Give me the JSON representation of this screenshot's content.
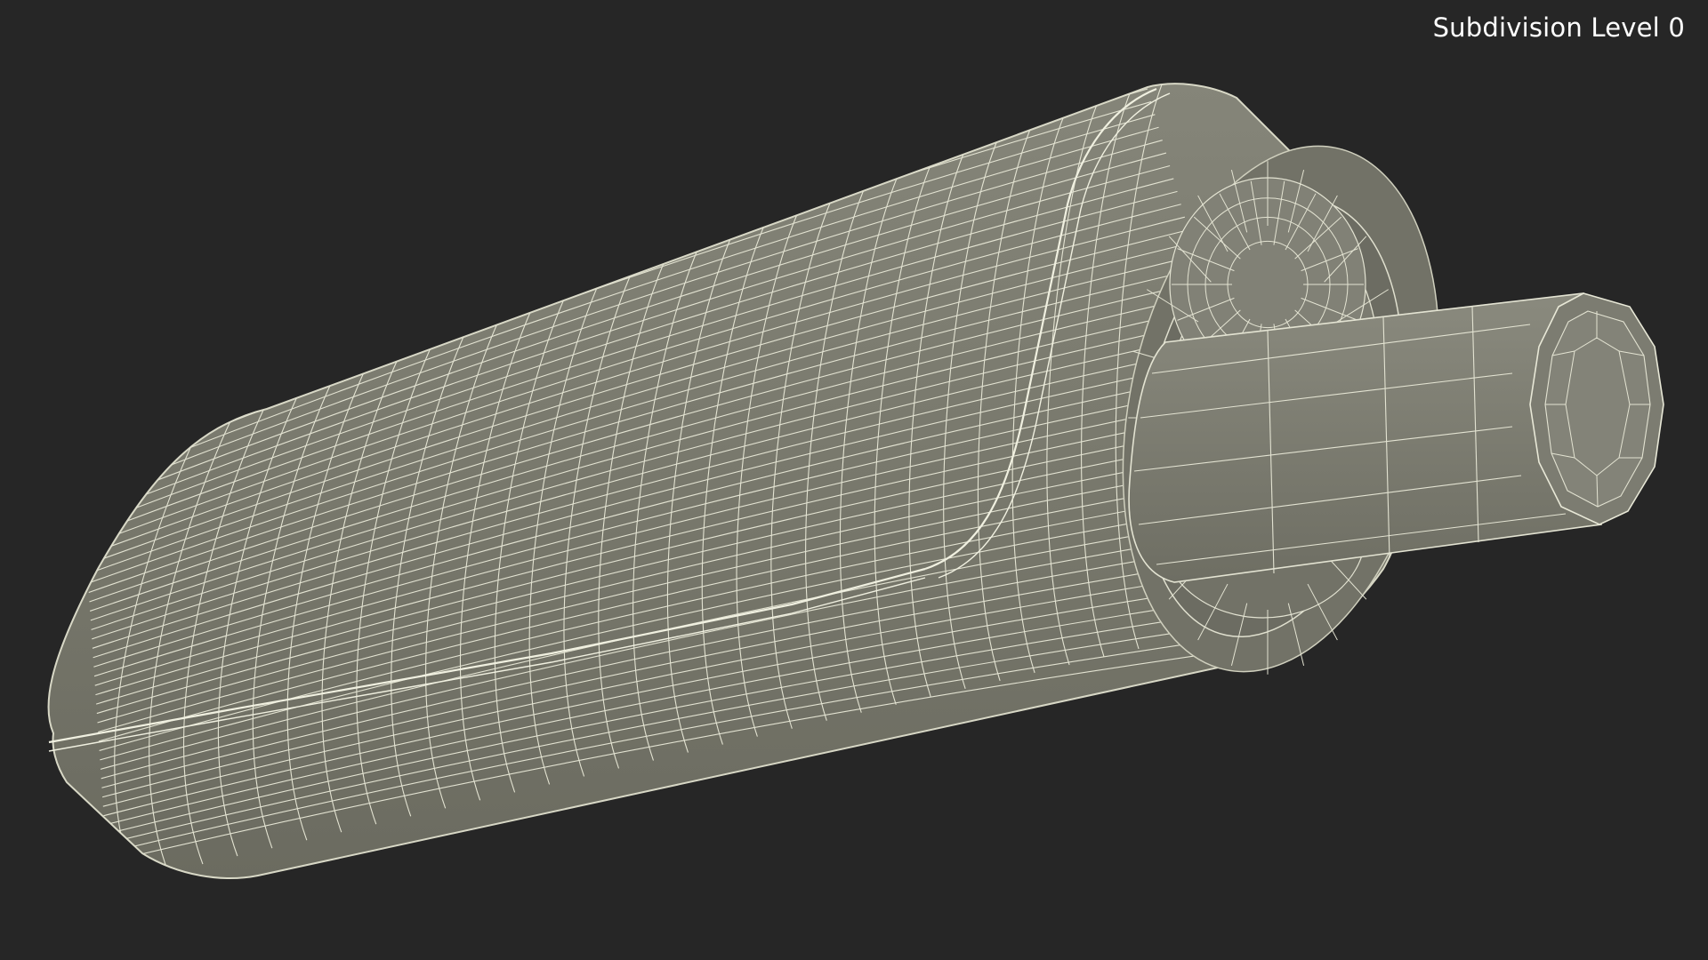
{
  "viewport": {
    "label": "Subdivision Level 0",
    "background_color": "#262626"
  },
  "model": {
    "surface_color": "#7a7a6f",
    "wire_color": "#e6e6d6",
    "parts": [
      "roller-body",
      "end-cap",
      "axle-shaft"
    ]
  }
}
